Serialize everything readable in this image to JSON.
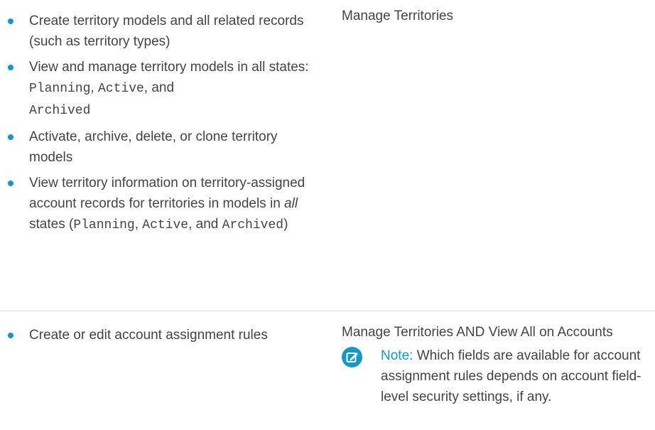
{
  "table": {
    "rows": [
      {
        "bullets": [
          {
            "segments": [
              {
                "text": "Create territory models and all related records (such as territory types)",
                "style": "normal"
              }
            ]
          },
          {
            "segments": [
              {
                "text": "View and manage territory models in all states: ",
                "style": "normal"
              },
              {
                "text": "Planning",
                "style": "mono"
              },
              {
                "text": ", ",
                "style": "normal"
              },
              {
                "text": "Active",
                "style": "mono"
              },
              {
                "text": ", and ",
                "style": "normal"
              },
              {
                "text": "Archived",
                "style": "mono"
              }
            ]
          },
          {
            "segments": [
              {
                "text": "Activate, archive, delete, or clone territory models",
                "style": "normal"
              }
            ]
          },
          {
            "segments": [
              {
                "text": "View territory information on territory-assigned account records for territories in models in ",
                "style": "normal"
              },
              {
                "text": "all",
                "style": "italic"
              },
              {
                "text": " states (",
                "style": "normal"
              },
              {
                "text": "Planning",
                "style": "mono"
              },
              {
                "text": ", ",
                "style": "normal"
              },
              {
                "text": "Active",
                "style": "mono"
              },
              {
                "text": ", and ",
                "style": "normal"
              },
              {
                "text": "Archived",
                "style": "mono"
              },
              {
                "text": ")",
                "style": "normal"
              }
            ]
          }
        ],
        "permission": "Manage Territories"
      },
      {
        "bullets": [
          {
            "segments": [
              {
                "text": "Create or edit account assignment rules",
                "style": "normal"
              }
            ]
          }
        ],
        "permission": "Manage Territories AND View All on Accounts",
        "note": {
          "label": "Note:",
          "text": "Which fields are available for account assignment rules depends on account field-level security settings, if any.",
          "icon": "edit-note-icon"
        }
      }
    ]
  },
  "colors": {
    "accent": "#1798c1",
    "text": "#444444",
    "divider": "#d8d8d8"
  }
}
